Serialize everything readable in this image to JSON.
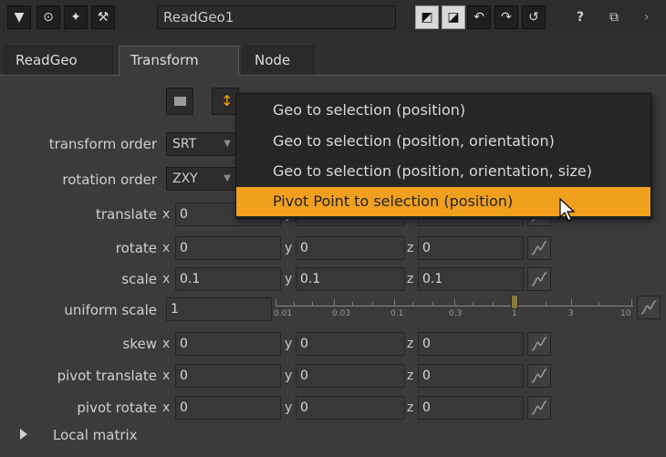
{
  "toolbar": {
    "node_name": "ReadGeo1",
    "help": "?",
    "float": "⧉"
  },
  "tabs": [
    "ReadGeo",
    "Transform",
    "Node"
  ],
  "rows": {
    "transform_order": {
      "label": "transform order",
      "value": "SRT"
    },
    "rotation_order": {
      "label": "rotation order",
      "value": "ZXY"
    },
    "translate": {
      "label": "translate",
      "x": "0",
      "y": "",
      "z": ""
    },
    "rotate": {
      "label": "rotate",
      "x": "0",
      "y": "0",
      "z": "0"
    },
    "scale": {
      "label": "scale",
      "x": "0.1",
      "y": "0.1",
      "z": "0.1"
    },
    "uniform_scale": {
      "label": "uniform scale",
      "value": "1",
      "ticks": [
        "0.01",
        "0.03",
        "0.1",
        "0.3",
        "1",
        "3",
        "10"
      ]
    },
    "skew": {
      "label": "skew",
      "x": "0",
      "y": "0",
      "z": "0"
    },
    "pivot_translate": {
      "label": "pivot translate",
      "x": "0",
      "y": "0",
      "z": "0"
    },
    "pivot_rotate": {
      "label": "pivot rotate",
      "x": "0",
      "y": "0",
      "z": "0"
    }
  },
  "axes": {
    "x": "x",
    "y": "y",
    "z": "z"
  },
  "local_matrix": "Local matrix",
  "menu": {
    "items": [
      "Geo to selection (position)",
      "Geo to selection (position, orientation)",
      "Geo to selection (position, orientation, size)",
      "Pivot Point to selection (position)"
    ],
    "highlighted_index": 3
  },
  "colors": {
    "highlight": "#f0a01e",
    "panel": "#3b3b3b"
  }
}
